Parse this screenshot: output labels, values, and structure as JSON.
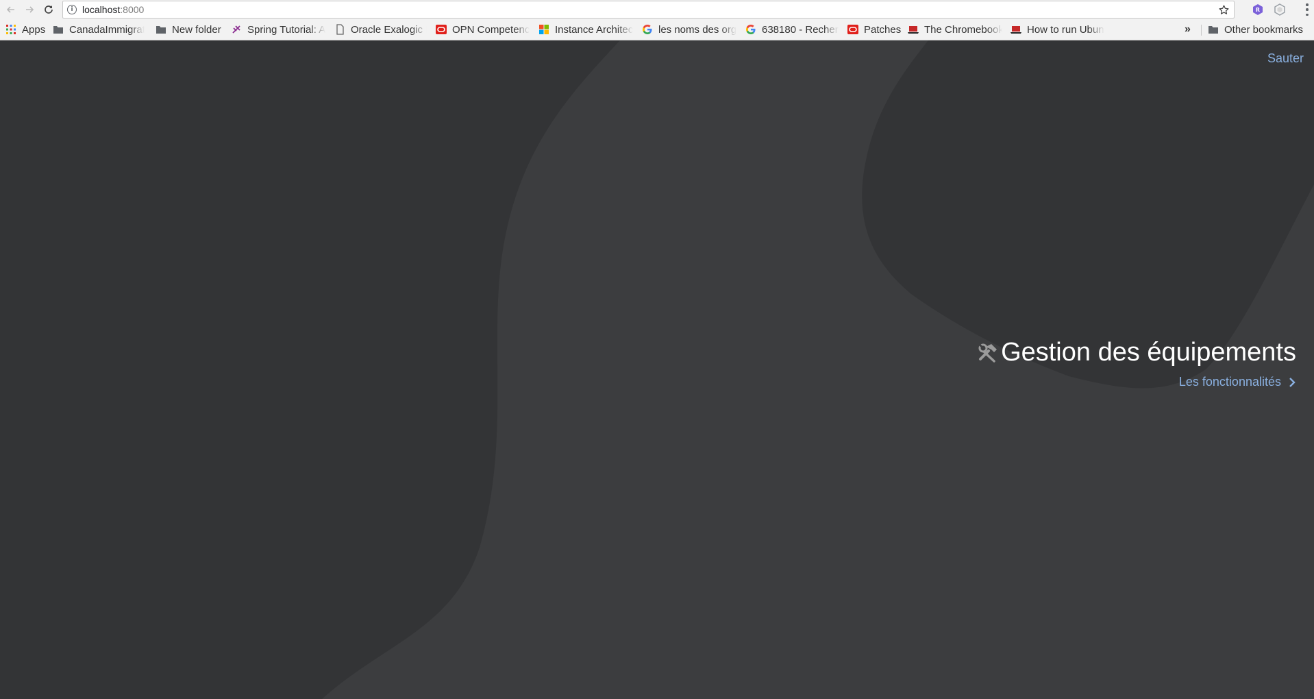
{
  "browser": {
    "url_host": "localhost",
    "url_port": ":8000",
    "bookmarks": [
      {
        "label": "Apps",
        "icon": "apps-grid-icon"
      },
      {
        "label": "CanadaImmigrati",
        "icon": "folder-icon"
      },
      {
        "label": "New folder",
        "icon": "folder-icon"
      },
      {
        "label": "Spring Tutorial: A",
        "icon": "spring-icon"
      },
      {
        "label": "Oracle Exalogic E",
        "icon": "page-icon"
      },
      {
        "label": "OPN Competenc",
        "icon": "oracle-icon"
      },
      {
        "label": "Instance Architec",
        "icon": "microsoft-icon"
      },
      {
        "label": "les noms des org",
        "icon": "google-icon"
      },
      {
        "label": "638180 - Recher",
        "icon": "google-icon"
      },
      {
        "label": "Patches",
        "icon": "oracle-icon"
      },
      {
        "label": "The Chromebook",
        "icon": "chromebook-icon"
      },
      {
        "label": "How to run Ubun",
        "icon": "chromebook-icon"
      }
    ],
    "more_bookmarks": "»",
    "other_bookmarks": "Other bookmarks"
  },
  "page": {
    "skip_label": "Sauter",
    "title": "Gestion des équipements",
    "features_link": "Les fonctionnalités",
    "icons": {
      "title": "tools-icon",
      "link": "chevron-right-icon"
    }
  },
  "colors": {
    "background": "#3c3d3f",
    "shape_dark": "#333436",
    "link": "#8ab0e0",
    "title": "#ffffff"
  }
}
